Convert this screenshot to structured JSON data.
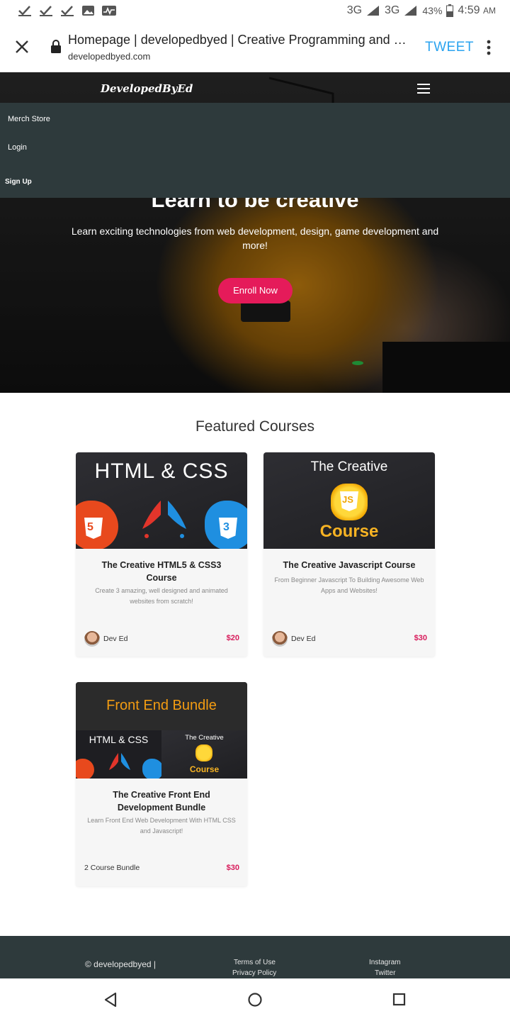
{
  "status_bar": {
    "network": "3G",
    "battery": "43%",
    "time": "4:59",
    "ampm": "AM"
  },
  "browser": {
    "page_title": "Homepage | developedbyed | Creative Programming and Desig...",
    "url": "developedbyed.com",
    "tweet_label": "TWEET"
  },
  "site": {
    "logo": "DevelopedByEd",
    "menu": [
      "Merch Store",
      "Login",
      "Sign Up"
    ],
    "hero_heading": "Learn to be creative",
    "hero_sub": "Learn exciting technologies from web development, design, game development and more!",
    "cta_label": "Enroll Now"
  },
  "featured_title": "Featured Courses",
  "courses": [
    {
      "thumb_text": "HTML & CSS",
      "title": "The Creative HTML5 & CSS3 Course",
      "desc": "Create 3 amazing, well designed and animated websites from scratch!",
      "author": "Dev Ed",
      "price": "$20"
    },
    {
      "thumb_line1": "The Creative",
      "thumb_line2": "Course",
      "title": "The Creative Javascript Course",
      "desc": "From Beginner Javascript To Building Awesome Web Apps and Websites!",
      "author": "Dev Ed",
      "price": "$30"
    },
    {
      "thumb_top": "Front End Bundle",
      "thumb_left": "HTML & CSS",
      "thumb_right_1": "The Creative",
      "thumb_right_2": "Course",
      "title": "The Creative Front End Development Bundle",
      "desc": "Learn Front End Web Development With HTML CSS and Javascript!",
      "author": "2 Course Bundle",
      "price": "$30"
    }
  ],
  "footer": {
    "copyright": "© developedbyed |",
    "links_1": [
      "Terms of Use",
      "Privacy Policy"
    ],
    "links_2": [
      "Instagram",
      "Twitter"
    ]
  },
  "colors": {
    "accent": "#e51b5a",
    "price": "#d81b5b",
    "menu_bg": "#2e3a3c",
    "tweet": "#2aa3ef"
  },
  "icons": [
    "check-icon",
    "image-icon",
    "activity-icon",
    "signal-icon",
    "battery-icon",
    "close-icon",
    "lock-icon",
    "more-vert-icon",
    "menu-icon",
    "back-icon",
    "home-icon",
    "recents-icon"
  ]
}
